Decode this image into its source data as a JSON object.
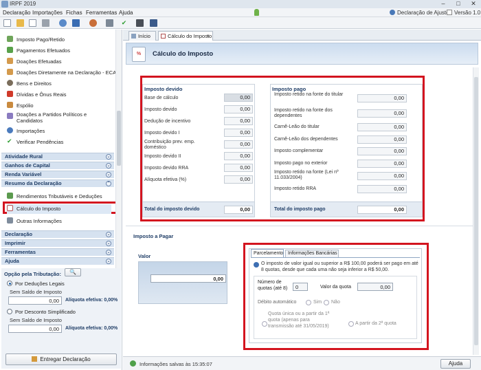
{
  "window": {
    "title": "IRPF 2019"
  },
  "menu": {
    "items": [
      "Declaração",
      "Importações",
      "Fichas",
      "Ferramentas",
      "Ajuda"
    ],
    "declaracao_ajuste": "Declaração de Ajuste",
    "versao": "Versão 1.0"
  },
  "sidebar": {
    "items": [
      "Imposto Pago/Retido",
      "Pagamentos Efetuados",
      "Doações Efetuadas",
      "Doações Diretamente na Declaração - ECA",
      "Bens e Direitos",
      "Dívidas e Ônus Reais",
      "Espólio",
      "Doações a Partidos Políticos e Candidatos",
      "Importações",
      "Verificar Pendências"
    ],
    "sections_top": [
      "Atividade Rural",
      "Ganhos de Capital",
      "Renda Variável",
      "Resumo da Declaração"
    ],
    "resumo_items": [
      "Rendimentos Tributáveis e Deduções",
      "Cálculo do Imposto",
      "Outras Informações"
    ],
    "sections_bottom": [
      "Declaração",
      "Imprimir",
      "Ferramentas",
      "Ajuda"
    ]
  },
  "opcao": {
    "title": "Opção pela Tributação:",
    "legais_label": "Por Deduções Legais",
    "legais_saldo_label": "Sem Saldo de Imposto",
    "legais_valor": "0,00",
    "legais_aliquota": "Alíquota efetiva: 0,00%",
    "simplificado_label": "Por Desconto Simplificado",
    "simplificado_saldo_label": "Sem Saldo de Imposto",
    "simplificado_valor": "0,00",
    "simplificado_aliquota": "Alíquota efetiva: 0,00%",
    "entregar_label": "Entregar Declaração"
  },
  "tabs": [
    "Início",
    "Cálculo do Imposto"
  ],
  "header": {
    "title": "Cálculo do Imposto",
    "icon_text": "%"
  },
  "imposto_devido": {
    "title": "Imposto devido",
    "rows": [
      {
        "label": "Base de cálculo",
        "value": "0,00"
      },
      {
        "label": "Imposto devido",
        "value": "0,00"
      },
      {
        "label": "Dedução de incentivo",
        "value": "0,00"
      },
      {
        "label": "Imposto devido I",
        "value": "0,00"
      },
      {
        "label": "Contribuição prev. emp. doméstico",
        "value": "0,00"
      },
      {
        "label": "Imposto devido II",
        "value": "0,00"
      },
      {
        "label": "Imposto devido RRA",
        "value": "0,00"
      },
      {
        "label": "Alíquota efetiva (%)",
        "value": "0,00"
      }
    ],
    "total_label": "Total do imposto devido",
    "total_value": "0,00"
  },
  "imposto_pago": {
    "title": "Imposto pago",
    "rows": [
      {
        "label": "Imposto retido na fonte do titular",
        "value": "0,00"
      },
      {
        "label": "Imposto retido na fonte dos dependentes",
        "value": "0,00"
      },
      {
        "label": "Carnê-Leão do titular",
        "value": "0,00"
      },
      {
        "label": "Carnê-Leão dos dependentes",
        "value": "0,00"
      },
      {
        "label": "Imposto complementar",
        "value": "0,00"
      },
      {
        "label": "Imposto pago no exterior",
        "value": "0,00"
      },
      {
        "label": "Imposto retido na fonte (Lei nº 11.033/2004)",
        "value": "0,00"
      },
      {
        "label": "Imposto retido RRA",
        "value": "0,00"
      }
    ],
    "total_label": "Total do imposto pago",
    "total_value": "0,00"
  },
  "imposto_pagar": {
    "title": "Imposto a Pagar",
    "valor_label": "Valor",
    "valor": "0,00",
    "tabs": [
      "Parcelamento",
      "Informações Bancárias"
    ],
    "info": "O imposto de valor igual ou superior a R$ 100,00 poderá ser pago em até 8 quotas, desde que cada uma não seja inferior a R$ 50,00.",
    "num_quotas_label": "Número de quotas (até 8)",
    "num_quotas": "0",
    "valor_quota_label": "Valor da quota",
    "valor_quota": "0,00",
    "debito_label": "Débito automático",
    "sim": "Sim",
    "nao": "Não",
    "quota_unica": "Quota única ou a partir da 1ª quota (apenas para transmissão até 31/05/2019)",
    "segunda_quota": "A partir da 2ª quota"
  },
  "status": {
    "text": "Informações salvas às 15:35:07",
    "ajuda": "Ajuda"
  }
}
